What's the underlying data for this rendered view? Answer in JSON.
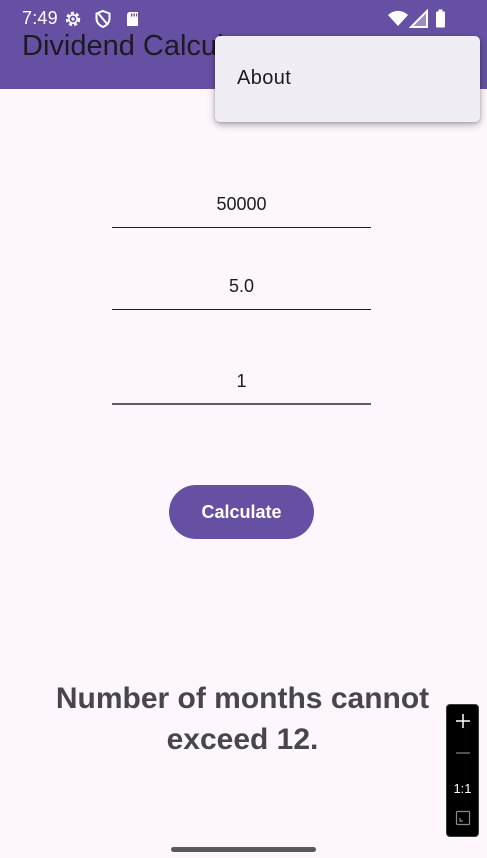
{
  "status_bar": {
    "time": "7:49"
  },
  "app_bar": {
    "title": "Dividend Calculator"
  },
  "overflow_menu": {
    "items": [
      {
        "label": "About"
      }
    ]
  },
  "form": {
    "fields": [
      {
        "value": "50000"
      },
      {
        "value": "5.0"
      },
      {
        "value": "1"
      }
    ],
    "calculate_label": "Calculate"
  },
  "result": {
    "message": "Number of months cannot exceed 12."
  },
  "zoom_controls": {
    "reset_label": "1:1"
  },
  "colors": {
    "primary": "#6650a4",
    "background": "#fdf7fd",
    "menu_surface": "#f0ecf4",
    "result_text": "#49454f"
  }
}
